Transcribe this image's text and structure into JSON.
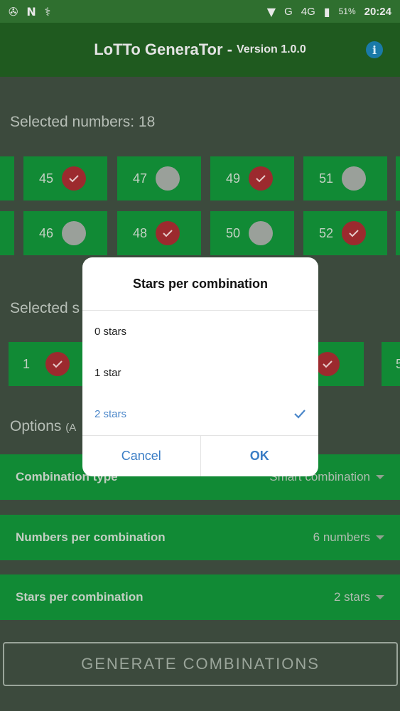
{
  "status_bar": {
    "left_icons": [
      "camera-aperture-icon",
      "n-icon",
      "usb-icon"
    ],
    "network_g": "G",
    "network_4g": "4G",
    "battery": "51%",
    "time": "20:24"
  },
  "app_bar": {
    "title": "LoTTo GeneraTor -",
    "version": "Version 1.0.0",
    "info_icon": "i"
  },
  "selected_numbers": {
    "label": "Selected numbers: 18",
    "row1": [
      {
        "num": "45",
        "checked": true
      },
      {
        "num": "47",
        "checked": false
      },
      {
        "num": "49",
        "checked": true
      },
      {
        "num": "51",
        "checked": false
      }
    ],
    "row2": [
      {
        "num": "46",
        "checked": false
      },
      {
        "num": "48",
        "checked": true
      },
      {
        "num": "50",
        "checked": false
      },
      {
        "num": "52",
        "checked": true
      }
    ]
  },
  "selected_stars": {
    "label_visible": "Selected s",
    "first_star": "1",
    "edge_star": "5"
  },
  "options": {
    "label_visible": "Options",
    "label_sub": "(A",
    "combination_type": {
      "label": "Combination type",
      "value": "Smart combination"
    },
    "numbers_per_combination": {
      "label": "Numbers per combination",
      "value": "6 numbers"
    },
    "stars_per_combination": {
      "label": "Stars per combination",
      "value": "2 stars"
    }
  },
  "generate_button": "GENERATE COMBINATIONS",
  "dialog": {
    "title": "Stars per combination",
    "options": [
      "0 stars",
      "1 star",
      "2 stars"
    ],
    "selected_index": 2,
    "cancel": "Cancel",
    "ok": "OK"
  },
  "colors": {
    "accent_green": "#118a35",
    "check_red": "#9c2a2e",
    "dialog_blue": "#3a7dc5"
  }
}
